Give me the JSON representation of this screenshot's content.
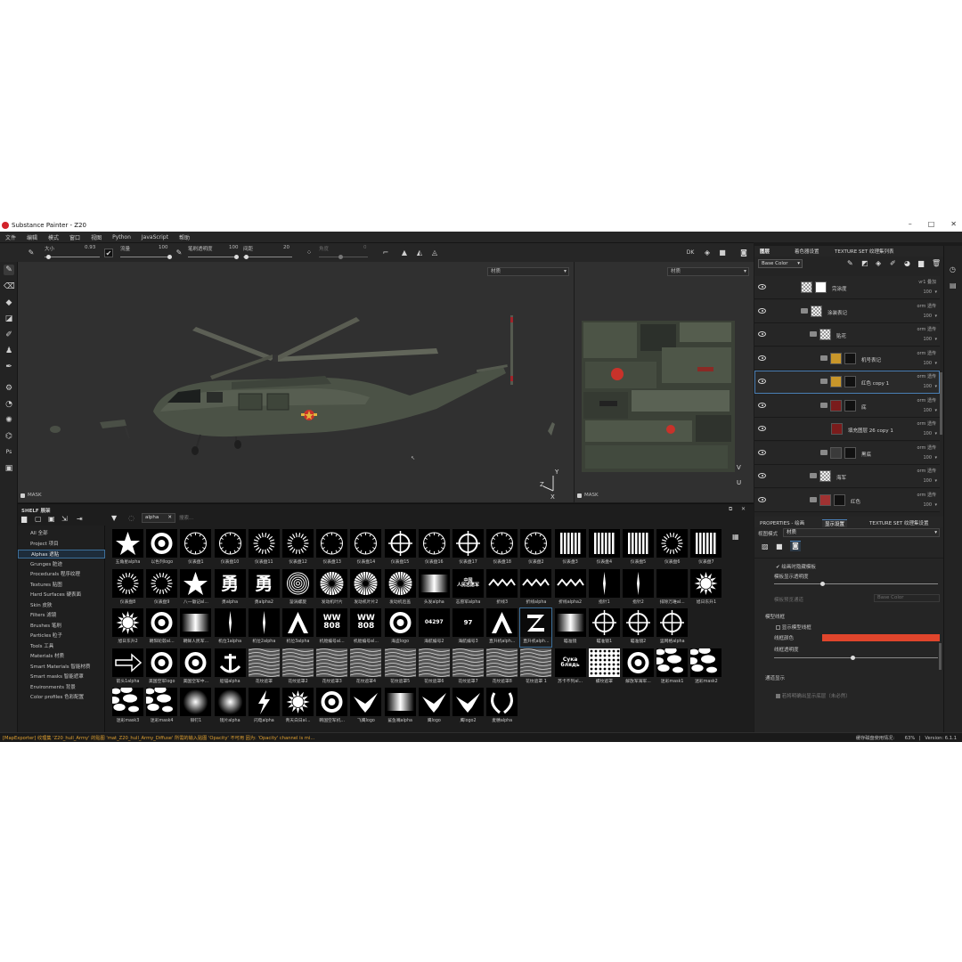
{
  "window": {
    "title": "Substance Painter - Z20"
  },
  "menu": [
    "文件",
    "编辑",
    "模式",
    "窗口",
    "视图",
    "Python",
    "JavaScript",
    "帮助"
  ],
  "toolbar": {
    "size_label": "大小",
    "size_value": "0.93",
    "flow_label": "流量",
    "flow_value": "100",
    "stroke_opacity_label": "笔刷透明度",
    "stroke_opacity_value": "100",
    "spacing_label": "间距",
    "spacing_value": "20",
    "angle_label": "角度",
    "angle_value": "0"
  },
  "viewport": {
    "left_mode": "材质",
    "right_mode": "材质",
    "left_mask": "MASK",
    "right_mask": "MASK"
  },
  "shelf": {
    "title": "SHELF 展架",
    "filter_tag": "alpha",
    "search_placeholder": "搜索...",
    "categories": [
      "All 全部",
      "Project 项目",
      "Alphas 遮贴",
      "Grunges 脏迹",
      "Procedurals 程序纹理",
      "Textures 贴图",
      "Hard Surfaces 硬表面",
      "Skin 皮肤",
      "Filters 滤镜",
      "Brushes 笔刷",
      "Particles 粒子",
      "Tools 工具",
      "Materials 材质",
      "Smart Materials 智能材质",
      "Smart masks 智能遮罩",
      "Environments 背景",
      "Color profiles 色彩配置"
    ],
    "selected_category": "Alphas 遮贴",
    "rows": [
      [
        "五角星alpha",
        "以色列logo",
        "仪表盘1",
        "仪表盘10",
        "仪表盘11",
        "仪表盘12",
        "仪表盘13",
        "仪表盘14",
        "仪表盘15",
        "仪表盘16",
        "仪表盘17",
        "仪表盘18",
        "仪表盘2",
        "仪表盘3",
        "仪表盘4",
        "仪表盘5",
        "仪表盘6",
        "仪表盘7"
      ],
      [
        "仪表盘8",
        "仪表盘9",
        "八一徽记al...",
        "勇alpha",
        "勇alpha2",
        "漩涡螺旋",
        "发动机叶片",
        "发动机叶片2",
        "发动机后盖",
        "头发alpha",
        "志愿军alpha",
        "折线3",
        "折线alpha",
        "折线alpha2",
        "指针1",
        "指针2",
        "排除万难al...",
        "旭日东升1"
      ],
      [
        "旭日东升2",
        "朝阳轮毂al...",
        "朝鲜人民军...",
        "机位1alpha",
        "机位2alpha",
        "机位3alpha",
        "机舱编号al...",
        "机舱编号al...",
        "海盗logo",
        "海航编号2",
        "海航编号3",
        "直升机alph...",
        "直升机alph...",
        "瞄准镜",
        "瞄准镜1",
        "瞄准镜2",
        "竖网格alpha",
        ""
      ],
      [
        "箭头1alpha",
        "美国空军logo",
        "美国空军中...",
        "船锚alpha",
        "花纹遮罩",
        "花纹遮罩2",
        "花纹遮罩3",
        "花纹遮罩4",
        "花纹遮罩5",
        "花纹遮罩6",
        "花纹遮罩7",
        "花纹遮罩8",
        "花纹遮罩 1",
        "苏卡不列al...",
        "螺纹遮罩",
        "解放军海军...",
        "迷彩mask1",
        "迷彩mask2"
      ],
      [
        "迷彩mask3",
        "迷彩mask4",
        "铆钉1",
        "镜片alpha",
        "闪电alpha",
        "青天白日al...",
        "韩国空军机...",
        "飞鹰logo",
        "鲨鱼嘴alpha",
        "鹰logo",
        "鹰logo2",
        "麦穗alpha"
      ]
    ],
    "thumb_text": {
      "ww": "WW",
      "num808": "808",
      "n04297": "04297",
      "n97": "97",
      "syka": "Сука блядь",
      "yong": "勇",
      "zhiyuan": "中国\n人民志愿军"
    }
  },
  "layers": {
    "tabs": [
      "图层",
      "着色器设置",
      "TEXTURE SET 纹理集列表"
    ],
    "channel": "Base Color",
    "items": [
      {
        "name": "完涂度",
        "blend": "vr1 叠加",
        "opacity": "100"
      },
      {
        "name": "涂装表记",
        "blend": "orm 透传",
        "opacity": "100"
      },
      {
        "name": "贴花",
        "blend": "orm 透传",
        "opacity": "100"
      },
      {
        "name": "机号表记",
        "blend": "orm 透传",
        "opacity": "100"
      },
      {
        "name": "红色 copy 1",
        "blend": "orm 透传",
        "opacity": "100"
      },
      {
        "name": "底",
        "blend": "orm 透传",
        "opacity": "100"
      },
      {
        "name": "填充图层 26 copy 1",
        "blend": "orm 透传",
        "opacity": "100"
      },
      {
        "name": "黑底",
        "blend": "orm 透传",
        "opacity": "100"
      },
      {
        "name": "海军",
        "blend": "orm 透传",
        "opacity": "100"
      },
      {
        "name": "红色",
        "blend": "orm 透传",
        "opacity": "100"
      }
    ]
  },
  "properties": {
    "tabs": [
      "PROPERTIES - 绘画",
      "显示设置",
      "TEXTURE SET 纹理集设置"
    ],
    "view_mode_label": "视图模式",
    "view_mode_value": "材质",
    "hide_unselected": "绘画时隐藏模板",
    "mask_display_opacity": "模板显示透明度",
    "mask_preview_channel": "模板预览通道",
    "mask_preview_channel_value": "Base Color",
    "wireframe_section": "模型线框",
    "show_wireframe": "显示模型线框",
    "wireframe_color_label": "线框颜色",
    "wireframe_color": "#e0452c",
    "wireframe_opacity": "线框透明度",
    "channel_section": "通道显示",
    "channel_checkbox": "若将明确出显示底层（未必然）"
  },
  "status": {
    "message": "[MapExporter] 纹理集 'Z20_hull_Army' 的贴图 'mat_Z20_hull_Army_Diffuse' 所需的输入贴图 'Opacity' 不可用 因为: 'Opacity' channel is mi...",
    "memory_label": "缓存磁盘使用情况:",
    "memory_value": "63%",
    "version": "Version: 6.1.1"
  }
}
